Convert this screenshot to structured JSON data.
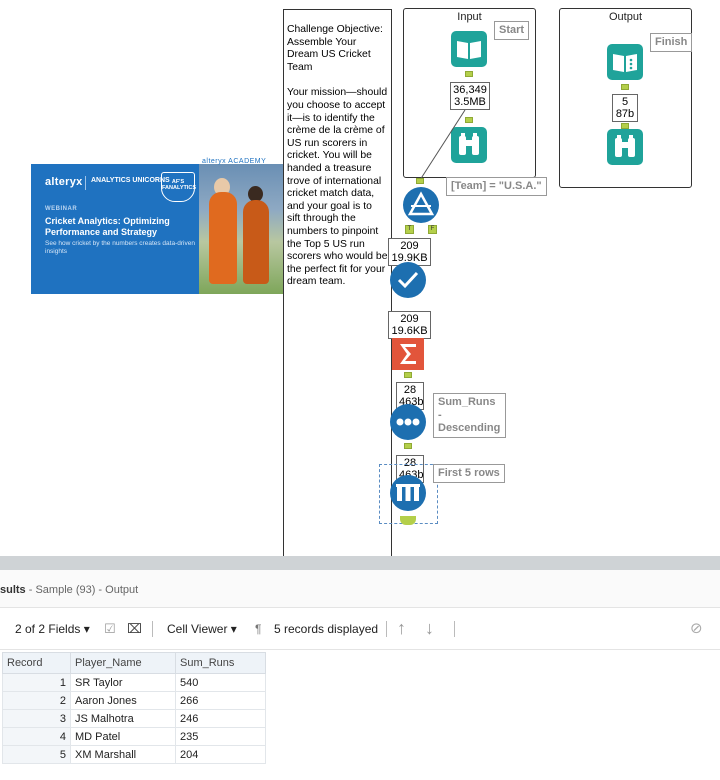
{
  "canvas": {
    "banner": {
      "brand": "alteryx",
      "brand_sub": "ANALYTICS UNICORNS",
      "badge": "AF'S FANALYTICS",
      "kicker": "WEBINAR",
      "title": "Cricket Analytics: Optimizing Performance and Strategy",
      "subtitle": "See how cricket by the numbers creates data-driven insights",
      "top_brand": "alteryx ACADEMY"
    },
    "comment": {
      "p1": "Challenge Objective: Assemble Your Dream US Cricket Team",
      "p2": "Your mission—should you choose to accept it—is to identify the crème de la crème of US run scorers in cricket. You will be handed a treasure trove of international cricket match data, and your goal is to sift through the numbers to pinpoint the Top 5 US run scorers who would be the perfect fit for your dream team."
    },
    "input_container": {
      "title": "Input",
      "start_label": "Start",
      "count": "36,349",
      "size": "3.5MB"
    },
    "output_container": {
      "title": "Output",
      "finish_label": "Finish",
      "count": "5",
      "size": "87b"
    },
    "filter": {
      "expression": "[Team] = \"U.S.A.\"",
      "true_anchor": "T",
      "false_anchor": "F",
      "count": "209",
      "size": "19.9KB"
    },
    "select": {
      "count": "209",
      "size": "19.6KB"
    },
    "summarize": {
      "count": "28",
      "size": "463b"
    },
    "sort": {
      "label": "Sum_Runs - Descending",
      "count": "28",
      "size": "463b"
    },
    "sample": {
      "label": "First 5 rows"
    }
  },
  "results": {
    "title_part": "sults",
    "subtitle": " - Sample (93) - Output",
    "toolbar": {
      "fields": "2 of 2 Fields",
      "viewer": "Cell Viewer",
      "records": "5 records displayed"
    },
    "columns": [
      "Record",
      "Player_Name",
      "Sum_Runs"
    ],
    "rows": [
      {
        "record": "1",
        "player": "SR Taylor",
        "runs": "540"
      },
      {
        "record": "2",
        "player": "Aaron Jones",
        "runs": "266"
      },
      {
        "record": "3",
        "player": "JS Malhotra",
        "runs": "246"
      },
      {
        "record": "4",
        "player": "MD Patel",
        "runs": "235"
      },
      {
        "record": "5",
        "player": "XM Marshall",
        "runs": "204"
      }
    ]
  },
  "colors": {
    "tool_blue": "#1d6fb0",
    "tool_teal": "#1fa39a",
    "summarize_red": "#e2553b",
    "connector": "#c8d86b"
  }
}
